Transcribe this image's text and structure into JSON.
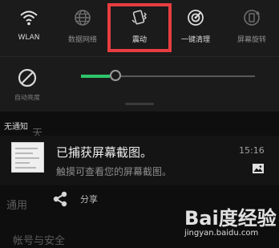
{
  "quick_settings": {
    "tiles": [
      {
        "label": "WLAN",
        "icon": "wifi-icon",
        "state": "on"
      },
      {
        "label": "数据网络",
        "icon": "globe-icon",
        "state": "off"
      },
      {
        "label": "震动",
        "icon": "vibrate-icon",
        "state": "highlighted"
      },
      {
        "label": "一键清理",
        "icon": "clean-icon",
        "state": "on"
      },
      {
        "label": "屏幕旋转",
        "icon": "rotate-icon",
        "state": "off"
      }
    ],
    "auto_brightness": {
      "label": "自动亮度",
      "icon": "no-auto-brightness-icon"
    },
    "brightness_level": 0.2,
    "highlight_color": "#e73d40",
    "slider_color": "#2fc46b"
  },
  "notifications": {
    "header": "无通知",
    "background_items": [
      "天",
      "通用",
      "帐号与安全"
    ],
    "items": [
      {
        "title": "已捕获屏幕截图。",
        "text": "触摸可查看您的屏幕截图。",
        "time": "15:16",
        "icon": "picture-icon",
        "action": "分享",
        "action_icon": "share-icon"
      }
    ]
  },
  "watermark": {
    "brand": "Bai度经验",
    "url": "jingyan.baidu.com"
  }
}
